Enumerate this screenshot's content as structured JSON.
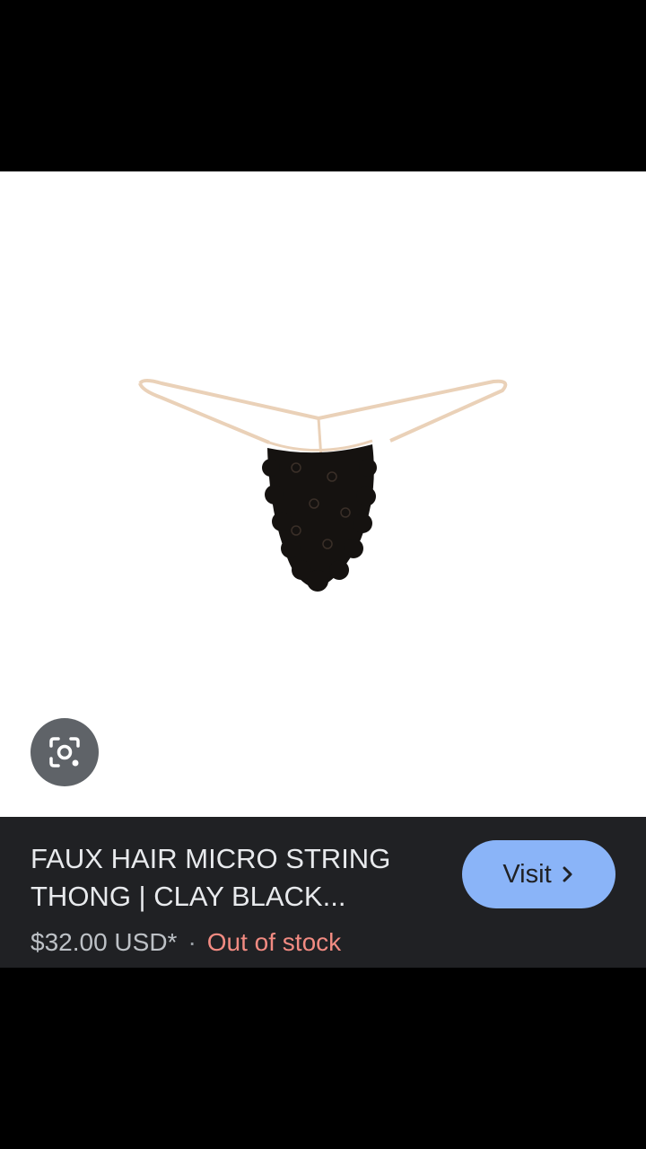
{
  "result": {
    "title": "FAUX HAIR MICRO STRING THONG | CLAY BLACK...",
    "price": "$32.00 USD*",
    "separator": "·",
    "stock_status": "Out of stock",
    "visit_label": "Visit"
  },
  "icons": {
    "lens": "google-lens-icon",
    "chevron": "chevron-right-icon"
  },
  "colors": {
    "info_bar_bg": "#202124",
    "visit_button_bg": "#8ab4f8",
    "stock_color": "#f28b82",
    "lens_button_bg": "#5f6368"
  }
}
